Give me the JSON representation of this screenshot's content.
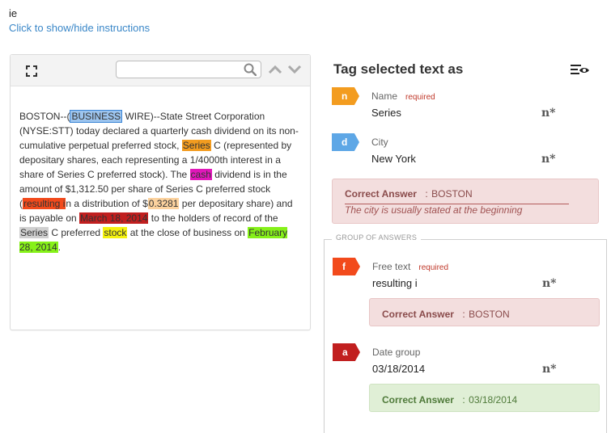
{
  "header": {
    "title": "ie",
    "toggle_link": "Click to show/hide instructions"
  },
  "toolbar": {
    "search_placeholder": "",
    "icons": [
      "expand-icon",
      "search-icon",
      "chevron-up-icon",
      "chevron-down-icon"
    ]
  },
  "document": {
    "segments": [
      {
        "text": "BOSTON--(",
        "hl": null
      },
      {
        "text": "BUSINESS",
        "hl": "business"
      },
      {
        "text": " WIRE)--State Street Corporation (NYSE:STT) today declared a quarterly cash dividend on its non-cumulative perpetual preferred stock, ",
        "hl": null
      },
      {
        "text": "Series",
        "hl": "series"
      },
      {
        "text": " C (represented by depositary shares, each representing a 1/4000th interest in a share of Series C preferred stock). The ",
        "hl": null
      },
      {
        "text": "cash",
        "hl": "cash"
      },
      {
        "text": " dividend is in the amount of $1,312.50 per share of Series C preferred stock (",
        "hl": null
      },
      {
        "text": "resulting i",
        "hl": "resulting"
      },
      {
        "text": "n a distribution of $",
        "hl": null
      },
      {
        "text": "0.3281",
        "hl": "amount"
      },
      {
        "text": " per depositary share) and is payable on ",
        "hl": null
      },
      {
        "text": "March 18, 2014",
        "hl": "date"
      },
      {
        "text": " to the holders of record of the ",
        "hl": null
      },
      {
        "text": "Series",
        "hl": "series2"
      },
      {
        "text": " C preferred ",
        "hl": null
      },
      {
        "text": "stock",
        "hl": "stock"
      },
      {
        "text": " at the close of business on ",
        "hl": null
      },
      {
        "text": "February 28, 2014",
        "hl": "feb"
      },
      {
        "text": ".",
        "hl": null
      }
    ]
  },
  "tag_panel": {
    "title": "Tag selected text as",
    "settings_icon": "list-eye-icon",
    "tags": [
      {
        "key": "n",
        "label": "Name",
        "required": "required",
        "value": "Series",
        "color": "#f39c1f",
        "marker": "n*"
      },
      {
        "key": "d",
        "label": "City",
        "required": "",
        "value": "New York",
        "color": "#5ea7e6",
        "marker": "n*"
      }
    ],
    "city_answer": {
      "label": "Correct Answer",
      "sep": ":",
      "value": "BOSTON",
      "hint": "The city is usually stated at the beginning"
    },
    "group": {
      "legend": "GROUP OF ANSWERS",
      "tags": [
        {
          "key": "f",
          "label": "Free text",
          "required": "required",
          "value": "resulting i",
          "color": "#f24a1c",
          "marker": "n*"
        },
        {
          "key": "a",
          "label": "Date group",
          "required": "",
          "value": "03/18/2014",
          "color": "#c11f1f",
          "marker": "n*"
        }
      ],
      "answers": [
        {
          "label": "Correct Answer",
          "sep": ":",
          "value": "BOSTON",
          "status": "incorrect"
        },
        {
          "label": "Correct Answer",
          "sep": ":",
          "value": "03/18/2014",
          "status": "correct"
        }
      ]
    }
  }
}
